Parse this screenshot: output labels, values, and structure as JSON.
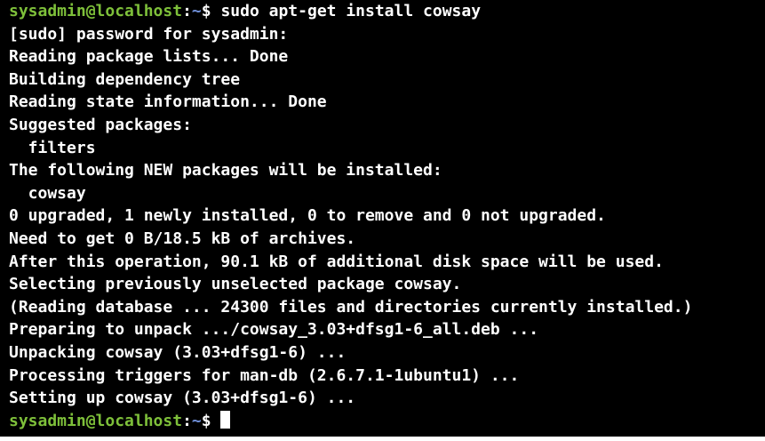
{
  "terminal": {
    "first_prompt": {
      "user_host": "sysadmin@localhost",
      "colon": ":",
      "path": "~",
      "symbol": "$ ",
      "command": "sudo apt-get install cowsay"
    },
    "output_lines": [
      "[sudo] password for sysadmin:",
      "Reading package lists... Done",
      "Building dependency tree",
      "Reading state information... Done",
      "Suggested packages:",
      "  filters",
      "The following NEW packages will be installed:",
      "  cowsay",
      "0 upgraded, 1 newly installed, 0 to remove and 0 not upgraded.",
      "Need to get 0 B/18.5 kB of archives.",
      "After this operation, 90.1 kB of additional disk space will be used.",
      "Selecting previously unselected package cowsay.",
      "(Reading database ... 24300 files and directories currently installed.)",
      "Preparing to unpack .../cowsay_3.03+dfsg1-6_all.deb ...",
      "Unpacking cowsay (3.03+dfsg1-6) ...",
      "Processing triggers for man-db (2.6.7.1-1ubuntu1) ...",
      "Setting up cowsay (3.03+dfsg1-6) ..."
    ],
    "last_prompt": {
      "user_host": "sysadmin@localhost",
      "colon": ":",
      "path": "~",
      "symbol": "$ "
    },
    "colors": {
      "background": "#000000",
      "text": "#ffffff",
      "prompt_user": "#7ec03a",
      "prompt_path": "#6f8fd8"
    }
  }
}
